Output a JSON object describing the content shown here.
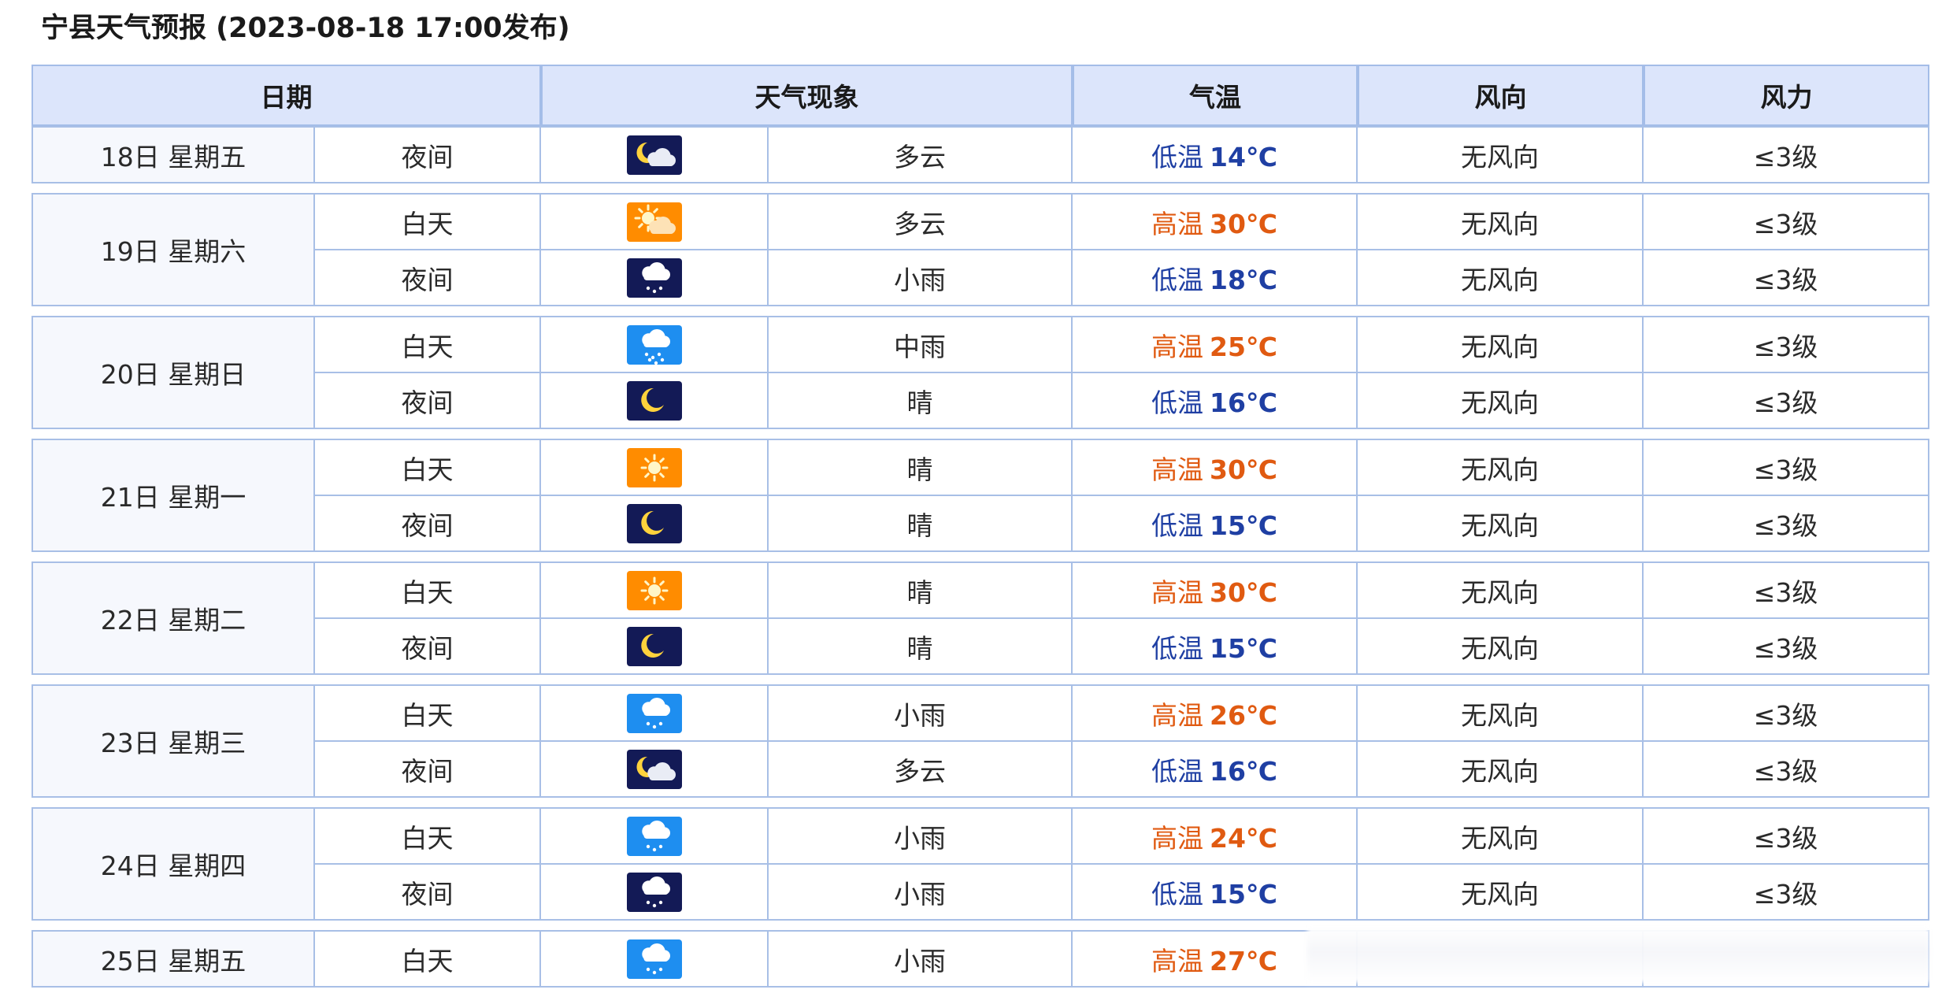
{
  "page": {
    "title": "宁县天气预报 (2023-08-18 17:00发布)"
  },
  "headers": {
    "date": "日期",
    "weather": "天气现象",
    "temperature": "气温",
    "wind_direction": "风向",
    "wind_force": "风力"
  },
  "colors": {
    "header_bg": "#dce5fb",
    "border": "#a8bfe6",
    "temp_high": "#e05a11",
    "temp_low": "#1f3fa3",
    "icon_night_bg": "#131a56",
    "icon_sun_bg": "#ff8c00",
    "icon_rain_bg": "#1e8ef0"
  },
  "days": [
    {
      "date": "18日 星期五",
      "periods": [
        {
          "period": "夜间",
          "icon": "moon-cloud-icon",
          "weather": "多云",
          "temp_label": "低温",
          "temp": "14℃",
          "type": "low",
          "wind_dir": "无风向",
          "wind_force": "≤3级"
        }
      ]
    },
    {
      "date": "19日 星期六",
      "periods": [
        {
          "period": "白天",
          "icon": "sun-cloud-icon",
          "weather": "多云",
          "temp_label": "高温",
          "temp": "30℃",
          "type": "high",
          "wind_dir": "无风向",
          "wind_force": "≤3级"
        },
        {
          "period": "夜间",
          "icon": "night-rain-icon",
          "weather": "小雨",
          "temp_label": "低温",
          "temp": "18℃",
          "type": "low",
          "wind_dir": "无风向",
          "wind_force": "≤3级"
        }
      ]
    },
    {
      "date": "20日 星期日",
      "periods": [
        {
          "period": "白天",
          "icon": "moderate-rain-icon",
          "weather": "中雨",
          "temp_label": "高温",
          "temp": "25℃",
          "type": "high",
          "wind_dir": "无风向",
          "wind_force": "≤3级"
        },
        {
          "period": "夜间",
          "icon": "moon-icon",
          "weather": "晴",
          "temp_label": "低温",
          "temp": "16℃",
          "type": "low",
          "wind_dir": "无风向",
          "wind_force": "≤3级"
        }
      ]
    },
    {
      "date": "21日 星期一",
      "periods": [
        {
          "period": "白天",
          "icon": "sun-icon",
          "weather": "晴",
          "temp_label": "高温",
          "temp": "30℃",
          "type": "high",
          "wind_dir": "无风向",
          "wind_force": "≤3级"
        },
        {
          "period": "夜间",
          "icon": "moon-icon",
          "weather": "晴",
          "temp_label": "低温",
          "temp": "15℃",
          "type": "low",
          "wind_dir": "无风向",
          "wind_force": "≤3级"
        }
      ]
    },
    {
      "date": "22日 星期二",
      "periods": [
        {
          "period": "白天",
          "icon": "sun-icon",
          "weather": "晴",
          "temp_label": "高温",
          "temp": "30℃",
          "type": "high",
          "wind_dir": "无风向",
          "wind_force": "≤3级"
        },
        {
          "period": "夜间",
          "icon": "moon-icon",
          "weather": "晴",
          "temp_label": "低温",
          "temp": "15℃",
          "type": "low",
          "wind_dir": "无风向",
          "wind_force": "≤3级"
        }
      ]
    },
    {
      "date": "23日 星期三",
      "periods": [
        {
          "period": "白天",
          "icon": "light-rain-icon",
          "weather": "小雨",
          "temp_label": "高温",
          "temp": "26℃",
          "type": "high",
          "wind_dir": "无风向",
          "wind_force": "≤3级"
        },
        {
          "period": "夜间",
          "icon": "moon-cloud-icon",
          "weather": "多云",
          "temp_label": "低温",
          "temp": "16℃",
          "type": "low",
          "wind_dir": "无风向",
          "wind_force": "≤3级"
        }
      ]
    },
    {
      "date": "24日 星期四",
      "periods": [
        {
          "period": "白天",
          "icon": "light-rain-icon",
          "weather": "小雨",
          "temp_label": "高温",
          "temp": "24℃",
          "type": "high",
          "wind_dir": "无风向",
          "wind_force": "≤3级"
        },
        {
          "period": "夜间",
          "icon": "night-rain-icon",
          "weather": "小雨",
          "temp_label": "低温",
          "temp": "15℃",
          "type": "low",
          "wind_dir": "无风向",
          "wind_force": "≤3级"
        }
      ]
    },
    {
      "date": "25日 星期五",
      "periods": [
        {
          "period": "白天",
          "icon": "light-rain-icon",
          "weather": "小雨",
          "temp_label": "高温",
          "temp": "27℃",
          "type": "high",
          "wind_dir": "",
          "wind_force": ""
        }
      ]
    }
  ]
}
